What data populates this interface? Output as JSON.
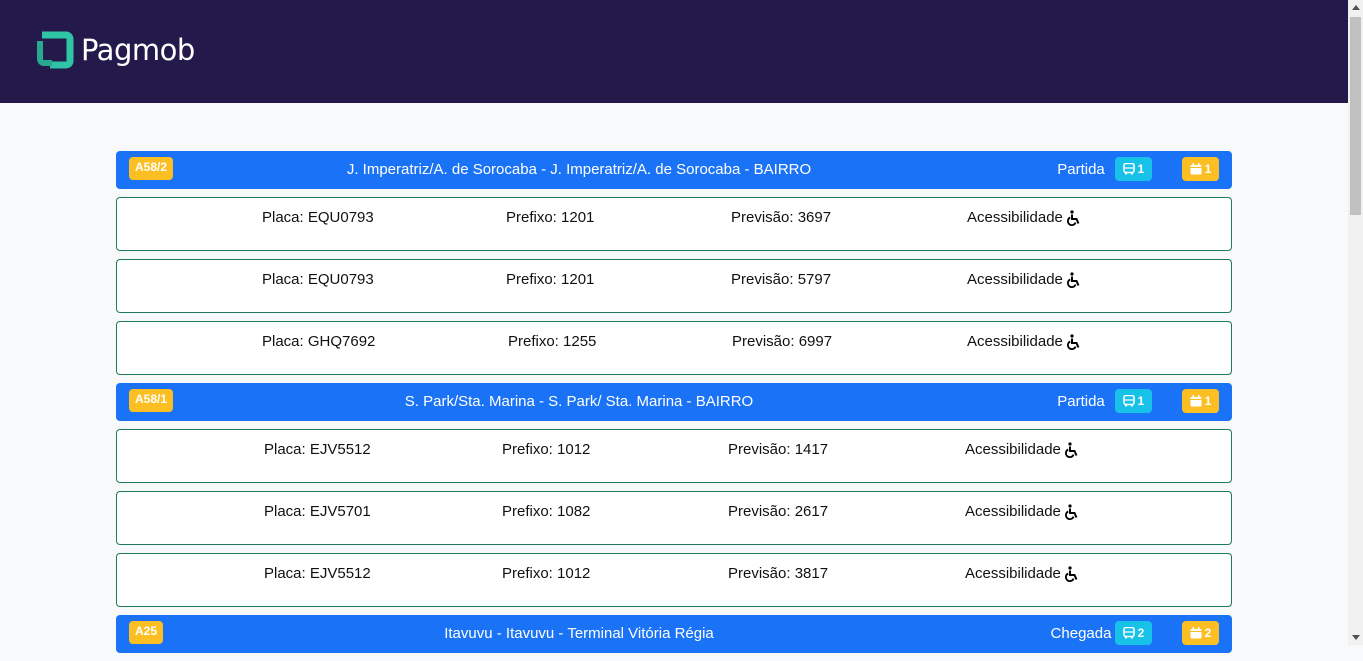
{
  "app": {
    "logo_text": "Pagmob",
    "colors": {
      "header": "#231a4b",
      "route_bar": "#1a73f6",
      "badge_yellow": "#fbbf24",
      "badge_cyan": "#17c1e8",
      "row_border": "#1f7a5a",
      "logo_teal": "#2ec4a5"
    }
  },
  "routes": [
    {
      "code": "A58/2",
      "name": "J. Imperatriz/A. de Sorocaba - J. Imperatriz/A. de Sorocaba - BAIRRO",
      "direction": "Partida",
      "bus_count": "1",
      "schedule_count": "1",
      "vehicles": [
        {
          "placa": "Placa: EQU0793",
          "prefixo": "Prefixo: 1201",
          "previsao": "Previsão: 3697",
          "acessibilidade": "Acessibilidade"
        },
        {
          "placa": "Placa: EQU0793",
          "prefixo": "Prefixo: 1201",
          "previsao": "Previsão: 5797",
          "acessibilidade": "Acessibilidade"
        },
        {
          "placa": "Placa: GHQ7692",
          "prefixo": "Prefixo: 1255",
          "previsao": "Previsão: 6997",
          "acessibilidade": "Acessibilidade"
        }
      ]
    },
    {
      "code": "A58/1",
      "name": "S. Park/Sta. Marina - S. Park/ Sta. Marina - BAIRRO",
      "direction": "Partida",
      "bus_count": "1",
      "schedule_count": "1",
      "vehicles": [
        {
          "placa": "Placa: EJV5512",
          "prefixo": "Prefixo: 1012",
          "previsao": "Previsão: 1417",
          "acessibilidade": "Acessibilidade"
        },
        {
          "placa": "Placa: EJV5701",
          "prefixo": "Prefixo: 1082",
          "previsao": "Previsão: 2617",
          "acessibilidade": "Acessibilidade"
        },
        {
          "placa": "Placa: EJV5512",
          "prefixo": "Prefixo: 1012",
          "previsao": "Previsão: 3817",
          "acessibilidade": "Acessibilidade"
        }
      ]
    },
    {
      "code": "A25",
      "name": "Itavuvu - Itavuvu - Terminal Vitória Régia",
      "direction": "Chegada",
      "bus_count": "2",
      "schedule_count": "2",
      "vehicles": []
    }
  ],
  "icons": {
    "bus": "bus-icon",
    "calendar": "calendar-icon",
    "accessibility": "wheelchair-icon"
  }
}
